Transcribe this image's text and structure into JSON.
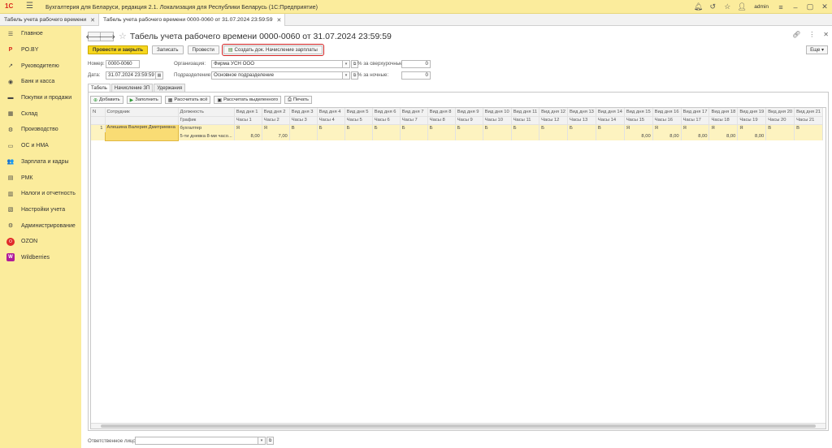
{
  "app": {
    "title": "Бухгалтерия для Беларуси, редакция 2.1. Локализация для Республики Беларусь   (1С:Предприятие)",
    "logo": "1С",
    "user": "admin"
  },
  "tabs": [
    {
      "label": "Табель учета рабочего времени"
    },
    {
      "label": "Табель учета рабочего времени 0000-0060 от 31.07.2024 23:59:59"
    }
  ],
  "sidebar": {
    "items": [
      {
        "label": "Главное",
        "icon": "list-icon",
        "glyph": "☰"
      },
      {
        "label": "PO.BY",
        "icon": "poby-icon",
        "glyph": "P"
      },
      {
        "label": "Руководителю",
        "icon": "chart-icon",
        "glyph": "↗"
      },
      {
        "label": "Банк и касса",
        "icon": "bank-icon",
        "glyph": "◉"
      },
      {
        "label": "Покупки и продажи",
        "icon": "cart-icon",
        "glyph": "▬"
      },
      {
        "label": "Склад",
        "icon": "warehouse-icon",
        "glyph": "▦"
      },
      {
        "label": "Производство",
        "icon": "factory-icon",
        "glyph": "⚙"
      },
      {
        "label": "ОС и НМА",
        "icon": "truck-icon",
        "glyph": "▭"
      },
      {
        "label": "Зарплата и кадры",
        "icon": "people-icon",
        "glyph": "👥"
      },
      {
        "label": "РМК",
        "icon": "register-icon",
        "glyph": "▤"
      },
      {
        "label": "Налоги и отчетность",
        "icon": "tax-icon",
        "glyph": "▥"
      },
      {
        "label": "Настройки учета",
        "icon": "settings-doc-icon",
        "glyph": "▧"
      },
      {
        "label": "Администрирование",
        "icon": "gear-icon",
        "glyph": "⚙"
      },
      {
        "label": "OZON",
        "icon": "ozon-icon",
        "glyph": "O"
      },
      {
        "label": "Wildberries",
        "icon": "wb-icon",
        "glyph": "W"
      }
    ]
  },
  "form": {
    "title": "Табель учета рабочего времени 0000-0060 от 31.07.2024 23:59:59",
    "toolbar": {
      "post_close": "Провести и закрыть",
      "save": "Записать",
      "post": "Провести",
      "create_doc": "Создать док. Начисление зарплаты",
      "more": "Еще ▾"
    },
    "fields": {
      "number_label": "Номер:",
      "number_value": "0000-0060",
      "date_label": "Дата:",
      "date_value": "31.07.2024 23:59:59",
      "org_label": "Организация:",
      "org_value": "Фирма УСН ООО",
      "dept_label": "Подразделение:",
      "dept_value": "Основное подразделение",
      "overtime_label": "% за сверхурочные:",
      "overtime_value": "0",
      "night_label": "% за ночные:",
      "night_value": "0"
    },
    "content_tabs": [
      "Табель",
      "Начисление ЗП",
      "Удержания"
    ],
    "table_toolbar": {
      "add": "Добавить",
      "fill": "Заполнить",
      "calc_all": "Рассчитать всё",
      "calc_selected": "Рассчитать выделенного",
      "print": "Печать"
    },
    "grid": {
      "head1": {
        "n": "N",
        "employee": "Сотрудник",
        "position": "Должность"
      },
      "head2": {
        "schedule": "График"
      },
      "day_kind_prefix": "Вид дня",
      "hours_prefix": "Часы",
      "days": [
        {
          "kind_h": "Вид дня 1",
          "hours_h": "Часы 1",
          "kind": "Я",
          "hours": "8,00"
        },
        {
          "kind_h": "Вид дня 2",
          "hours_h": "Часы 2",
          "kind": "Я",
          "hours": "7,00"
        },
        {
          "kind_h": "Вид дня 3",
          "hours_h": "Часы 3",
          "kind": "В",
          "hours": ""
        },
        {
          "kind_h": "Вид дня 4",
          "hours_h": "Часы 4",
          "kind": "Б",
          "hours": ""
        },
        {
          "kind_h": "Вид дня 5",
          "hours_h": "Часы 5",
          "kind": "Б",
          "hours": ""
        },
        {
          "kind_h": "Вид дня 6",
          "hours_h": "Часы 6",
          "kind": "Б",
          "hours": ""
        },
        {
          "kind_h": "Вид дня 7",
          "hours_h": "Часы 7",
          "kind": "Б",
          "hours": ""
        },
        {
          "kind_h": "Вид дня 8",
          "hours_h": "Часы 8",
          "kind": "Б",
          "hours": ""
        },
        {
          "kind_h": "Вид дня 9",
          "hours_h": "Часы 9",
          "kind": "Б",
          "hours": ""
        },
        {
          "kind_h": "Вид дня 10",
          "hours_h": "Часы 10",
          "kind": "Б",
          "hours": ""
        },
        {
          "kind_h": "Вид дня 11",
          "hours_h": "Часы 11",
          "kind": "Б",
          "hours": ""
        },
        {
          "kind_h": "Вид дня 12",
          "hours_h": "Часы 12",
          "kind": "Б",
          "hours": ""
        },
        {
          "kind_h": "Вид дня 13",
          "hours_h": "Часы 13",
          "kind": "Б",
          "hours": ""
        },
        {
          "kind_h": "Вид дня 14",
          "hours_h": "Часы 14",
          "kind": "В",
          "hours": ""
        },
        {
          "kind_h": "Вид дня 15",
          "hours_h": "Часы 15",
          "kind": "Я",
          "hours": "8,00"
        },
        {
          "kind_h": "Вид дня 16",
          "hours_h": "Часы 16",
          "kind": "Я",
          "hours": "8,00"
        },
        {
          "kind_h": "Вид дня 17",
          "hours_h": "Часы 17",
          "kind": "Я",
          "hours": "8,00"
        },
        {
          "kind_h": "Вид дня 18",
          "hours_h": "Часы 18",
          "kind": "Я",
          "hours": "8,00"
        },
        {
          "kind_h": "Вид дня 19",
          "hours_h": "Часы 19",
          "kind": "Я",
          "hours": "8,00"
        },
        {
          "kind_h": "Вид дня 20",
          "hours_h": "Часы 20",
          "kind": "В",
          "hours": ""
        },
        {
          "kind_h": "Вид дня 21",
          "hours_h": "Часы 21",
          "kind": "В",
          "hours": ""
        }
      ],
      "row": {
        "n": "1",
        "employee": "Алешина Валерия Дмитриевна",
        "position": "бухгалтер",
        "schedule": "5-ти дневка 8-ми часо..."
      }
    },
    "footer": {
      "responsible_label": "Ответственное лицо:",
      "responsible_value": ""
    }
  },
  "colors": {
    "brand_yellow": "#fbec9c",
    "primary_button": "#f6d61e",
    "highlight_outline": "#d12020",
    "selected_row": "#fdf3c0"
  }
}
